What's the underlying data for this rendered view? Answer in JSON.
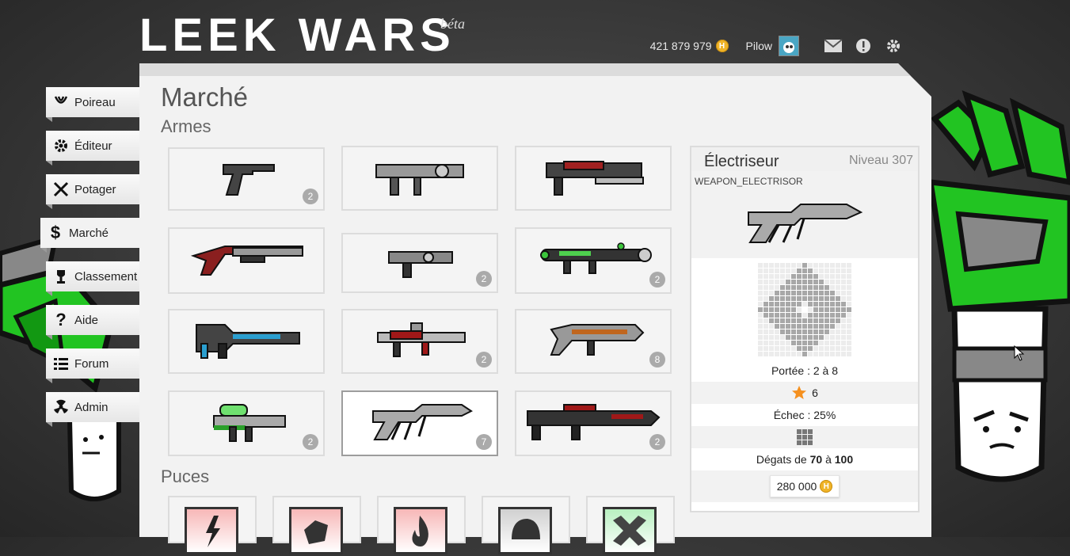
{
  "logo": {
    "text": "LEEK WARS",
    "tag": "béta"
  },
  "topbar": {
    "habs": "421 879 979",
    "username": "Pilow",
    "icons": [
      "habs-coin-icon",
      "avatar",
      "mail-icon",
      "warning-icon",
      "settings-gear-icon"
    ]
  },
  "sidebar": {
    "items": [
      {
        "label": "Poireau",
        "icon": "leek-icon"
      },
      {
        "label": "Éditeur",
        "icon": "gear-icon"
      },
      {
        "label": "Potager",
        "icon": "crossed-swords-icon"
      },
      {
        "label": "Marché",
        "icon": "dollar-icon",
        "active": true
      },
      {
        "label": "Classement",
        "icon": "trophy-icon"
      },
      {
        "label": "Aide",
        "icon": "question-icon"
      },
      {
        "label": "Forum",
        "icon": "list-icon"
      },
      {
        "label": "Admin",
        "icon": "radiation-icon"
      }
    ]
  },
  "main": {
    "title": "Marché",
    "weapons_heading": "Armes",
    "chips_heading": "Puces",
    "weapons": [
      {
        "icon": "pistol-icon",
        "count": "2"
      },
      {
        "icon": "machine-gun-icon",
        "count": ""
      },
      {
        "icon": "double-gun-icon",
        "count": ""
      },
      {
        "icon": "shotgun-icon",
        "count": ""
      },
      {
        "icon": "magnum-icon",
        "count": "2"
      },
      {
        "icon": "laser-icon",
        "count": "2"
      },
      {
        "icon": "destroyer-icon",
        "count": ""
      },
      {
        "icon": "flamethrower-icon",
        "count": "2"
      },
      {
        "icon": "gazor-icon",
        "count": "8"
      },
      {
        "icon": "grenade-launcher-icon",
        "count": "2"
      },
      {
        "icon": "electrisor-icon",
        "count": "7",
        "selected": true
      },
      {
        "icon": "m-laser-icon",
        "count": "2"
      }
    ],
    "chips": [
      {
        "icon": "lightning-chip-icon"
      },
      {
        "icon": "rock-chip-icon"
      },
      {
        "icon": "flame-chip-icon"
      },
      {
        "icon": "helmet-chip-icon"
      },
      {
        "icon": "bandage-chip-icon"
      }
    ]
  },
  "detail": {
    "name": "Électriseur",
    "level": "Niveau 307",
    "code": "WEAPON_ELECTRISOR",
    "range_label": "Portée : 2 à 8",
    "cost": "6",
    "failure": "Échec : 25%",
    "damage_prefix": "Dégats de",
    "damage_min": "70",
    "damage_join": "à",
    "damage_max": "100",
    "price": "280 000"
  },
  "colors": {
    "leek_green": "#22c422",
    "panel_bg": "#f2f2f2",
    "coin": "#f0b428",
    "star": "#f5901e"
  }
}
